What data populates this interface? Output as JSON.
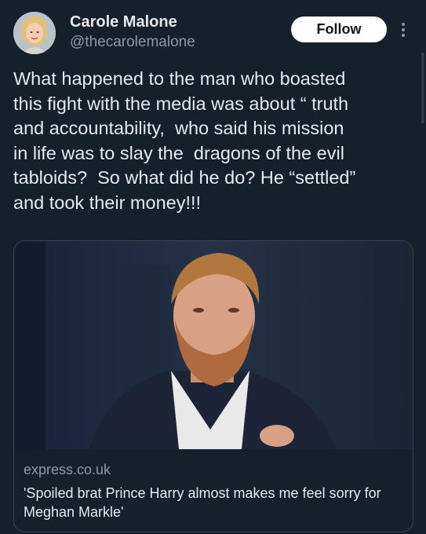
{
  "author": {
    "display_name": "Carole Malone",
    "handle": "@thecarolemalone",
    "avatar_icon": "profile-photo"
  },
  "actions": {
    "follow_label": "Follow",
    "more_icon": "more-vertical-icon"
  },
  "tweet": {
    "text": "What happened to the man who boasted\nthis fight with the media was about “ truth\nand accountability,  who said his mission\nin life was to slay the  dragons of the evil\ntabloids?  So what did he do? He “settled”\nand took their money!!!"
  },
  "link_card": {
    "domain": "express.co.uk",
    "title": "'Spoiled brat Prince Harry almost makes me feel sorry for Meghan Markle'"
  },
  "colors": {
    "background": "#15202b",
    "text_primary": "#e7e9ea",
    "text_secondary": "#8b98a5",
    "border": "#38444d",
    "follow_button_bg": "#ffffff"
  }
}
